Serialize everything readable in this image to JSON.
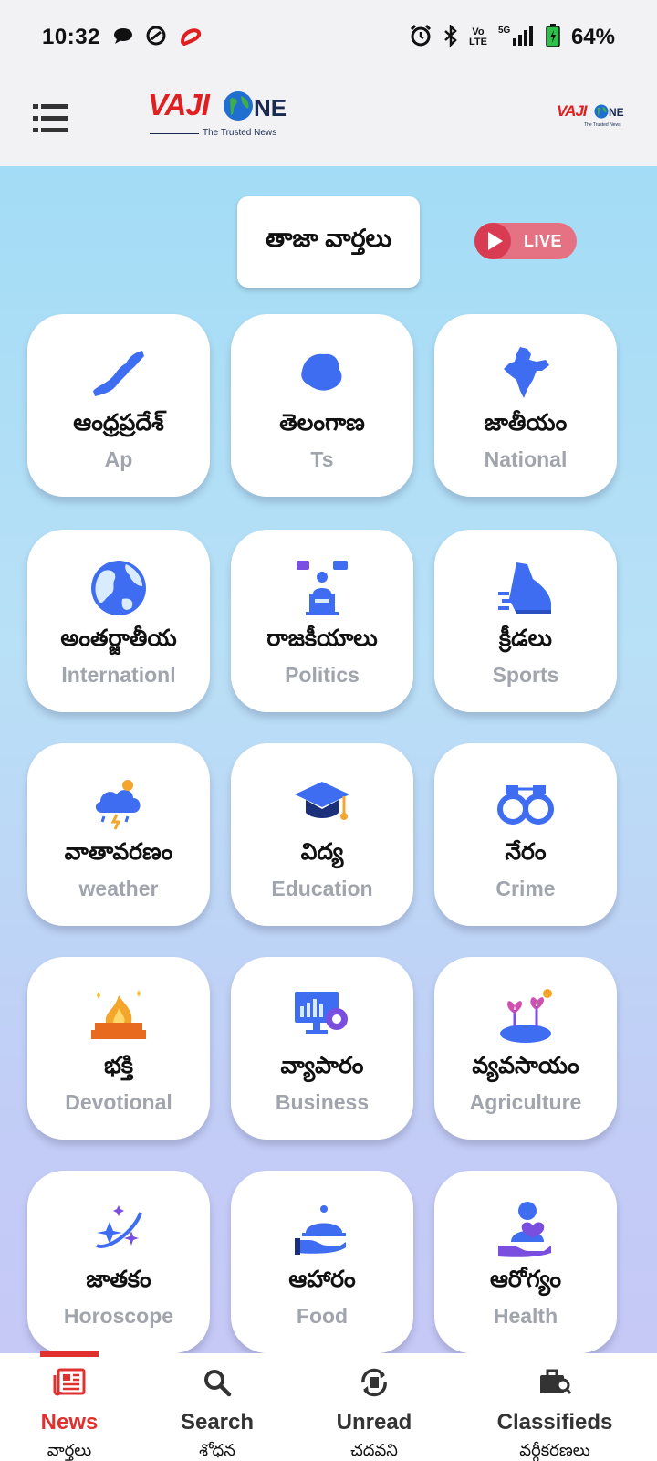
{
  "status_bar": {
    "time": "10:32",
    "battery": "64%",
    "volte_top": "Vo",
    "volte_bottom": "LTE",
    "network": "5G"
  },
  "header": {
    "logo_word": "VAJI",
    "logo_suffix": "NE",
    "logo_tagline": "The Trusted News"
  },
  "latest_news": {
    "label": "తాజా వార్తలు"
  },
  "live": {
    "label": "LIVE"
  },
  "categories": [
    {
      "te": "ఆంధ్రప్రదేశ్",
      "en": "Ap",
      "icon": "ap-map-icon"
    },
    {
      "te": "తెలంగాణ",
      "en": "Ts",
      "icon": "ts-map-icon"
    },
    {
      "te": "జాతీయం",
      "en": "National",
      "icon": "india-map-icon"
    },
    {
      "te": "అంతర్జాతీయ",
      "en": "Internationl",
      "icon": "globe-icon"
    },
    {
      "te": "రాజకీయాలు",
      "en": "Politics",
      "icon": "podium-speaker-icon"
    },
    {
      "te": "క్రీడలు",
      "en": "Sports",
      "icon": "running-shoe-icon"
    },
    {
      "te": "వాతావరణం",
      "en": "weather",
      "icon": "storm-cloud-icon"
    },
    {
      "te": "విద్య",
      "en": "Education",
      "icon": "graduation-cap-icon"
    },
    {
      "te": "నేరం",
      "en": "Crime",
      "icon": "handcuffs-icon"
    },
    {
      "te": "భక్తి",
      "en": "Devotional",
      "icon": "sacred-fire-icon"
    },
    {
      "te": "వ్యాపారం",
      "en": "Business",
      "icon": "business-monitor-icon"
    },
    {
      "te": "వ్యవసాయం",
      "en": "Agriculture",
      "icon": "sprouting-plants-icon"
    },
    {
      "te": "జాతకం",
      "en": "Horoscope",
      "icon": "stars-orbit-icon"
    },
    {
      "te": "ఆహారం",
      "en": "Food",
      "icon": "food-cloche-icon"
    },
    {
      "te": "ఆరోగ్యం",
      "en": "Health",
      "icon": "health-care-icon"
    }
  ],
  "bottom_nav": [
    {
      "en": "News",
      "te": "వార్తలు",
      "icon": "newspaper-icon",
      "active": true
    },
    {
      "en": "Search",
      "te": "శోధన",
      "icon": "search-icon",
      "active": false
    },
    {
      "en": "Unread",
      "te": "చదవని",
      "icon": "unread-refresh-icon",
      "active": false
    },
    {
      "en": "Classifieds",
      "te": "వర్గీకరణలు",
      "icon": "briefcase-search-icon",
      "active": false
    }
  ],
  "colors": {
    "brand_red": "#e02020",
    "brand_navy": "#1a2a4f",
    "active_nav": "#e0312f",
    "icon_blue": "#3f6df2",
    "icon_purple": "#7a4fe0",
    "label_gray": "#a0a4ac"
  }
}
